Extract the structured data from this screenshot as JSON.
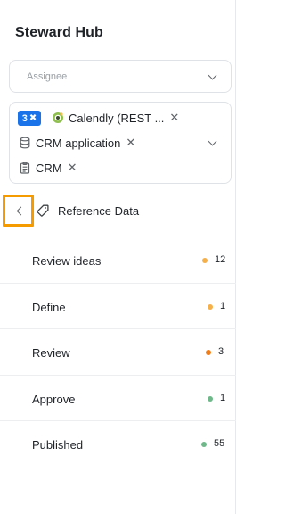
{
  "app": {
    "title": "Steward Hub"
  },
  "assignee": {
    "placeholder": "Assignee"
  },
  "filters": {
    "count_label": "3",
    "chips": [
      {
        "label": "Calendly (REST ...",
        "icon": "calendly-icon"
      },
      {
        "label": "CRM application",
        "icon": "database-icon"
      },
      {
        "label": "CRM",
        "icon": "clipboard-icon"
      }
    ]
  },
  "breadcrumb": {
    "label": "Reference Data",
    "icon": "tag-icon"
  },
  "statuses": [
    {
      "label": "Review ideas",
      "count": "12",
      "color": "#f6b04a"
    },
    {
      "label": "Define",
      "count": "1",
      "color": "#f6b04a"
    },
    {
      "label": "Review",
      "count": "3",
      "color": "#ef7d1a"
    },
    {
      "label": "Approve",
      "count": "1",
      "color": "#6fb88a"
    },
    {
      "label": "Published",
      "count": "55",
      "color": "#6fb88a"
    }
  ]
}
